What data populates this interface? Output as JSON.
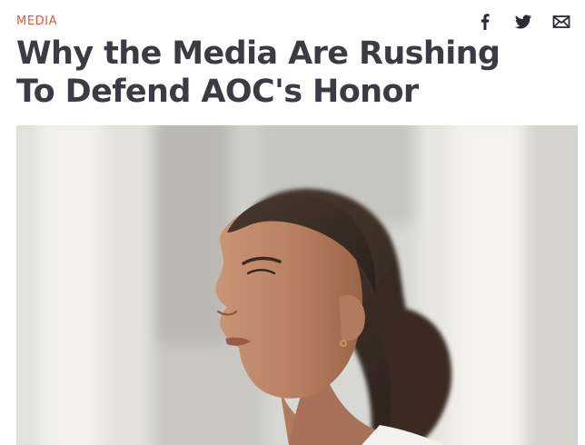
{
  "article": {
    "category": "MEDIA",
    "headline": "Why the Media Are Rushing To Defend AOC's Honor"
  },
  "share": {
    "icons": [
      "facebook-icon",
      "twitter-icon",
      "email-icon"
    ]
  },
  "colors": {
    "category": "#e25a3b",
    "headline": "#3b3b45",
    "icon": "#2b2b35"
  }
}
